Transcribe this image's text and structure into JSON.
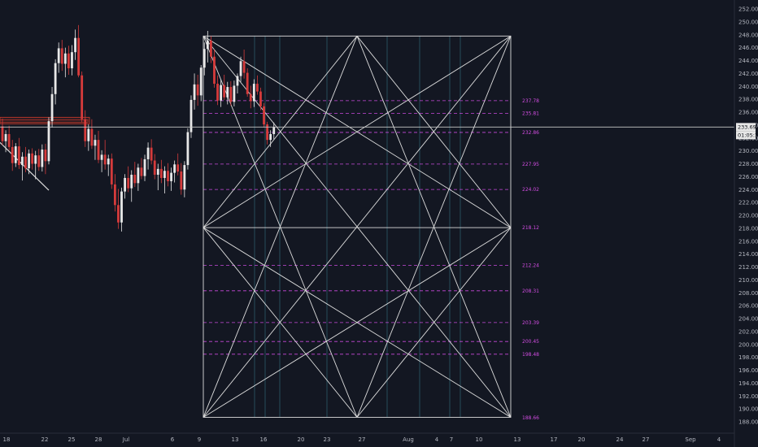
{
  "colors": {
    "background": "#131722",
    "candle_up": "#e8e8e8",
    "candle_down": "#d63b3b",
    "grid_box": "#dcdcdc",
    "gann_level": "#c74adb",
    "vertical_guides": "#2d5a6a",
    "axis_text": "#b2b5be",
    "zone_box": "#c0392b"
  },
  "current_price": {
    "value": 233.69,
    "label": "233.69",
    "timer": "01:05:39"
  },
  "chart_data": {
    "type": "candlestick",
    "y_axis": {
      "min": 187,
      "max": 253,
      "ticks": [
        "252.00",
        "250.00",
        "248.00",
        "246.00",
        "244.00",
        "242.00",
        "240.00",
        "238.00",
        "236.00",
        "234.00",
        "232.00",
        "230.00",
        "228.00",
        "226.00",
        "224.00",
        "222.00",
        "220.00",
        "218.00",
        "216.00",
        "214.00",
        "212.00",
        "210.00",
        "208.00",
        "206.00",
        "204.00",
        "202.00",
        "200.00",
        "198.00",
        "196.00",
        "194.00",
        "192.00",
        "190.00",
        "188.00"
      ]
    },
    "x_axis": {
      "ticks": [
        "18",
        "22",
        "25",
        "28",
        "Jul",
        "6",
        "9",
        "13",
        "16",
        "20",
        "23",
        "27",
        "Aug",
        "4",
        "7",
        "10",
        "13",
        "17",
        "20",
        "24",
        "27",
        "Sep",
        "4"
      ]
    },
    "gann_box": {
      "top": 247.8,
      "bottom": 188.7,
      "mid": 218.1
    },
    "gann_levels": [
      {
        "label": "237.78",
        "value": 237.78
      },
      {
        "label": "235.81",
        "value": 235.81
      },
      {
        "label": "232.86",
        "value": 232.86
      },
      {
        "label": "227.95",
        "value": 227.95
      },
      {
        "label": "224.02",
        "value": 224.02
      },
      {
        "label": "218.12",
        "value": 218.12
      },
      {
        "label": "212.24",
        "value": 212.24
      },
      {
        "label": "208.31",
        "value": 208.31
      },
      {
        "label": "203.39",
        "value": 203.39
      },
      {
        "label": "200.45",
        "value": 200.45
      },
      {
        "label": "198.48",
        "value": 198.48
      },
      {
        "label": "188.66",
        "value": 188.66
      }
    ],
    "zone": {
      "top": 235.2,
      "bottom": 234.2
    },
    "trendline": {
      "start": 231.3,
      "end": 223.9
    },
    "candles": [
      [
        233.8,
        235.0,
        230.9,
        231.5
      ],
      [
        231.5,
        233.2,
        229.8,
        232.6
      ],
      [
        232.6,
        233.9,
        230.1,
        230.6
      ],
      [
        230.6,
        231.7,
        226.9,
        228.1
      ],
      [
        228.1,
        231.2,
        227.5,
        230.7
      ],
      [
        230.7,
        232.0,
        227.2,
        227.8
      ],
      [
        227.8,
        229.8,
        225.4,
        229.1
      ],
      [
        229.1,
        230.6,
        226.7,
        227.3
      ],
      [
        227.3,
        230.2,
        226.4,
        229.6
      ],
      [
        229.6,
        230.4,
        227.1,
        228.0
      ],
      [
        228.0,
        230.0,
        225.6,
        229.3
      ],
      [
        229.3,
        230.3,
        226.9,
        227.5
      ],
      [
        227.5,
        231.0,
        226.8,
        230.2
      ],
      [
        230.2,
        231.1,
        226.4,
        228.4
      ],
      [
        228.4,
        235.2,
        227.9,
        234.6
      ],
      [
        234.6,
        239.9,
        233.6,
        238.8
      ],
      [
        238.8,
        244.2,
        237.2,
        243.6
      ],
      [
        243.6,
        246.8,
        242.1,
        245.9
      ],
      [
        245.9,
        247.2,
        242.4,
        243.5
      ],
      [
        243.5,
        246.0,
        241.4,
        245.1
      ],
      [
        245.1,
        246.3,
        241.8,
        242.8
      ],
      [
        242.8,
        246.4,
        241.7,
        245.3
      ],
      [
        245.3,
        248.8,
        244.1,
        247.5
      ],
      [
        247.5,
        249.5,
        241.4,
        241.7
      ],
      [
        241.7,
        242.3,
        234.4,
        234.9
      ],
      [
        234.9,
        236.3,
        230.6,
        231.5
      ],
      [
        231.5,
        234.1,
        230.0,
        233.4
      ],
      [
        233.4,
        234.9,
        230.3,
        230.8
      ],
      [
        230.8,
        232.5,
        228.6,
        231.7
      ],
      [
        231.7,
        233.1,
        228.1,
        228.6
      ],
      [
        228.6,
        230.1,
        226.7,
        229.4
      ],
      [
        229.4,
        231.7,
        227.1,
        227.9
      ],
      [
        227.9,
        229.4,
        226.1,
        228.8
      ],
      [
        228.8,
        229.6,
        224.1,
        224.8
      ],
      [
        224.8,
        226.4,
        220.6,
        221.6
      ],
      [
        221.6,
        224.1,
        217.9,
        218.9
      ],
      [
        218.9,
        224.3,
        217.5,
        223.7
      ],
      [
        223.7,
        226.4,
        222.6,
        225.8
      ],
      [
        225.8,
        227.6,
        223.6,
        224.2
      ],
      [
        224.2,
        227.0,
        222.1,
        226.3
      ],
      [
        226.3,
        228.3,
        224.4,
        225.0
      ],
      [
        225.0,
        228.0,
        223.8,
        227.4
      ],
      [
        227.4,
        228.9,
        225.6,
        226.1
      ],
      [
        226.1,
        229.4,
        225.3,
        228.7
      ],
      [
        228.7,
        231.3,
        227.1,
        230.5
      ],
      [
        230.5,
        231.8,
        227.9,
        228.5
      ],
      [
        228.5,
        229.5,
        225.6,
        226.3
      ],
      [
        226.3,
        228.0,
        223.9,
        227.2
      ],
      [
        227.2,
        228.6,
        225.0,
        225.8
      ],
      [
        225.8,
        227.6,
        223.4,
        226.9
      ],
      [
        226.9,
        228.1,
        224.5,
        225.3
      ],
      [
        225.3,
        227.4,
        223.8,
        226.6
      ],
      [
        226.6,
        228.5,
        225.1,
        227.9
      ],
      [
        227.9,
        229.6,
        226.2,
        226.8
      ],
      [
        226.8,
        228.1,
        223.2,
        224.0
      ],
      [
        224.0,
        228.4,
        222.8,
        227.8
      ],
      [
        227.8,
        233.5,
        227.1,
        232.9
      ],
      [
        232.9,
        238.6,
        232.0,
        237.9
      ],
      [
        237.9,
        242.0,
        236.4,
        240.3
      ],
      [
        240.3,
        241.8,
        237.0,
        238.6
      ],
      [
        238.6,
        243.3,
        237.7,
        242.9
      ],
      [
        242.9,
        246.8,
        241.7,
        245.8
      ],
      [
        245.8,
        248.6,
        243.7,
        247.1
      ],
      [
        247.1,
        247.8,
        243.6,
        244.6
      ],
      [
        244.6,
        245.7,
        239.8,
        240.4
      ],
      [
        240.4,
        241.7,
        237.1,
        237.8
      ],
      [
        237.8,
        241.1,
        236.8,
        240.2
      ],
      [
        240.2,
        241.8,
        237.9,
        238.3
      ],
      [
        238.3,
        240.7,
        237.2,
        239.9
      ],
      [
        239.9,
        240.8,
        237.0,
        237.6
      ],
      [
        237.6,
        240.9,
        236.9,
        240.1
      ],
      [
        240.1,
        242.0,
        238.9,
        241.6
      ],
      [
        241.6,
        244.6,
        240.7,
        243.9
      ],
      [
        243.9,
        245.7,
        241.2,
        242.1
      ],
      [
        242.1,
        242.8,
        238.4,
        238.8
      ],
      [
        238.8,
        240.1,
        236.6,
        237.7
      ],
      [
        237.7,
        241.1,
        236.8,
        240.4
      ],
      [
        240.4,
        241.7,
        238.7,
        239.2
      ],
      [
        239.2,
        239.8,
        236.3,
        236.9
      ],
      [
        236.9,
        237.4,
        233.6,
        234.1
      ],
      [
        234.1,
        234.5,
        231.0,
        231.7
      ],
      [
        231.7,
        233.2,
        230.6,
        232.6
      ],
      [
        232.6,
        234.4,
        231.8,
        233.7
      ]
    ]
  }
}
